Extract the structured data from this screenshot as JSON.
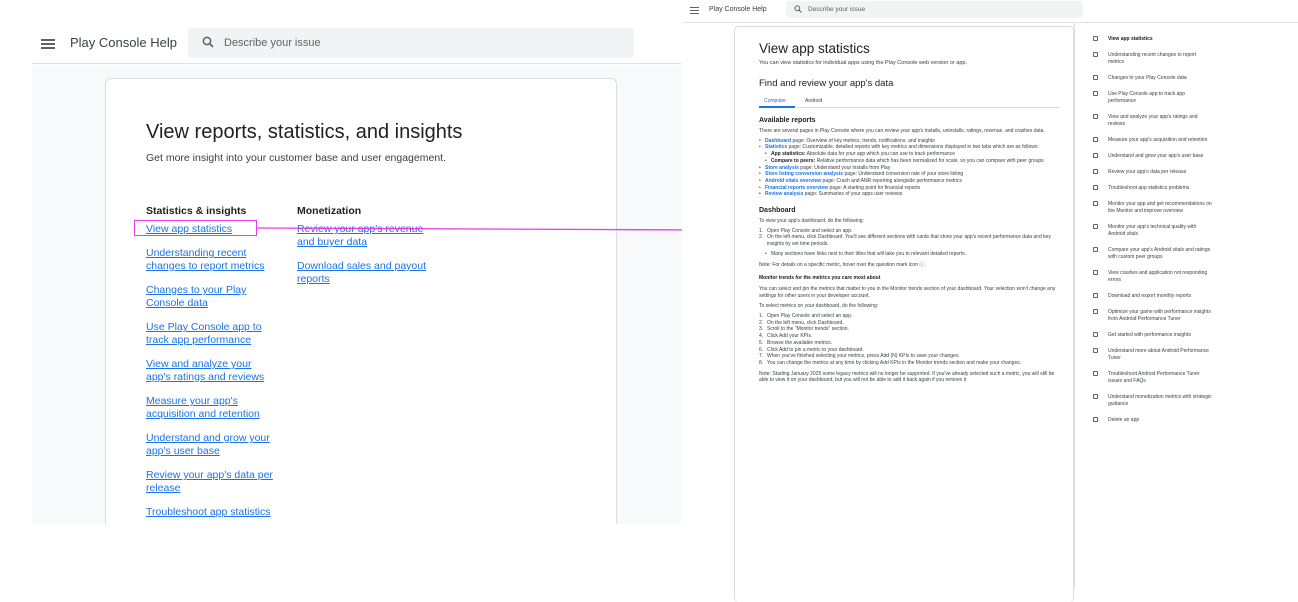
{
  "left": {
    "brand": "Play Console Help",
    "search_placeholder": "Describe your issue",
    "title": "View reports, statistics, and insights",
    "subtitle": "Get more insight into your customer base and user engagement.",
    "col1": {
      "heading": "Statistics & insights",
      "links": [
        "View app statistics",
        "Understanding recent changes to report metrics",
        "Changes to your Play Console data",
        "Use Play Console app to track app performance",
        "View and analyze your app's ratings and reviews",
        "Measure your app's acquisition and retention",
        "Understand and grow your app's user base",
        "Review your app's data per release",
        "Troubleshoot app statistics"
      ]
    },
    "col2": {
      "heading": "Monetization",
      "links": [
        "Review your app's revenue and buyer data",
        "Download sales and payout reports"
      ]
    }
  },
  "right": {
    "brand": "Play Console Help",
    "search_placeholder": "Describe your issue",
    "title": "View app statistics",
    "subtitle": "You can view statistics for individual apps using the Play Console web version or app.",
    "section_title": "Find and review your app's data",
    "tabs": [
      "Computer",
      "Android"
    ],
    "available_reports": {
      "heading": "Available reports",
      "intro": "There are several pages in Play Console where you can review your app's installs, uninstalls, ratings, revenue, and crashes data.",
      "items": [
        {
          "link": "Dashboard",
          "rest": " page: Overview of key metrics, trends, notifications, and insights"
        },
        {
          "link": "Statistics",
          "rest": " page: Customizable, detailed reports with key metrics and dimensions displayed in two tabs which are as follows:"
        },
        {
          "link": "Store analysis",
          "rest": " page: Understand your installs from Play"
        },
        {
          "link": "Store listing conversion analysis",
          "rest": " page: Understand conversion rate of your store listing"
        },
        {
          "link": "Android vitals overview",
          "rest": " page: Crash and ANR reporting alongside performance metrics"
        },
        {
          "link": "Financial reports overview",
          "rest": " page: A starting point for financial reports"
        },
        {
          "link": "Review analysis",
          "rest": " page: Summaries of your apps user reviews"
        }
      ],
      "sub_items": [
        {
          "bold": "App statistics:",
          "rest": " Absolute data for your app which you can use to track performance"
        },
        {
          "bold": "Compare to peers:",
          "rest": " Relative performance data which has been normalized for scale, so you can compare with peer groups"
        }
      ]
    },
    "dashboard": {
      "heading": "Dashboard",
      "intro": "To view your app's dashboard, do the following:",
      "steps": [
        "Open Play Console and select an app.",
        "On the left menu, click Dashboard. You'll see different sections with cards that show your app's recent performance data and key insights by set time periods."
      ],
      "sub_step": "Many sections have links next to their titles that will take you to relevant detailed reports.",
      "note": "Note: For details on a specific metric, hover over the question mark icon ⓘ."
    },
    "monitor": {
      "heading": "Monitor trends for the metrics you care most about",
      "intro": "You can select and pin the metrics that matter to you in the Monitor trends section of your dashboard. Your selection won't change any settings for other users in your developer account.",
      "intro2": "To select metrics on your dashboard, do the following:",
      "steps": [
        "Open Play Console and select an app.",
        "On the left menu, click Dashboard.",
        "Scroll to the \"Monitor trends\" section.",
        "Click Add your KPIs.",
        "Browse the available metrics.",
        "Click Add to pin a metric to your dashboard.",
        "When you've finished selecting your metrics, press Add (N) KPIs to save your changes.",
        "You can change the metrics at any time by clicking Add KPIs in the Monitor trends section and make your changes."
      ],
      "note": "Note: Starting January 2025 some legacy metrics will no longer be supported. If you've already selected such a metric, you will still be able to view it on your dashboard, but you will not be able to add it back again if you remove it"
    },
    "sidebar": [
      "View app statistics",
      "Understanding recent changes to report metrics",
      "Changes to your Play Console data",
      "Use Play Console app to track app performance",
      "View and analyze your app's ratings and reviews",
      "Measure your app's acquisition and retention",
      "Understand and grow your app's user base",
      "Review your app's data per release",
      "Troubleshoot app statistics problems",
      "Monitor your app and get recommendations on the Monitor and improve overview",
      "Monitor your app's technical quality with Android vitals",
      "Compare your app's Android vitals and ratings with custom peer groups",
      "View crashes and application not responding errors",
      "Download and export monthly reports",
      "Optimize your game with performance insights from Android Performance Tuner",
      "Get started with performance insights",
      "Understand more about Android Performance Tuner",
      "Troubleshoot Android Performance Tuner issues and FAQs",
      "Understand monetization metrics with strategic guidance",
      "Delete an app"
    ]
  },
  "colors": {
    "link": "#1a73e8",
    "annotation": "#e83cf0"
  }
}
